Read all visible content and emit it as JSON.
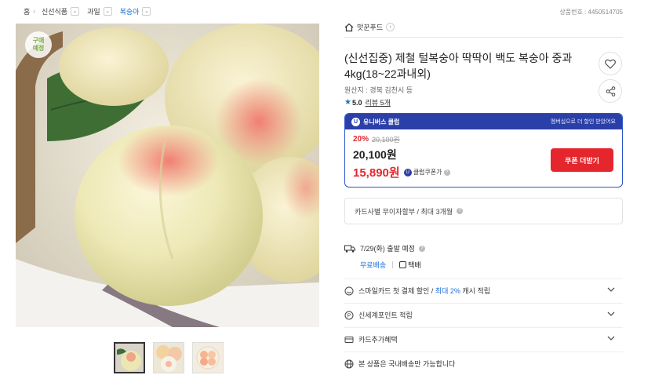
{
  "breadcrumb": [
    {
      "label": "홈"
    },
    {
      "label": "신선식품"
    },
    {
      "label": "과일"
    },
    {
      "label": "복숭아"
    }
  ],
  "product_no": "상품번호 : 4450514705",
  "image": {
    "badge": "구매\n예정"
  },
  "brand": {
    "name": "맛꾼푸드"
  },
  "title": "(신선집중) 제철 털복숭아 딱딱이 백도 복숭아 중과 4kg(18~22과내외)",
  "origin": "원산지 : 경북 김천시 등",
  "rating": {
    "score": "5.0",
    "reviews": "리뷰 5개"
  },
  "club": {
    "name": "유니버스 클럽",
    "promo": "멤버십으로 더 할인 받았어요",
    "discount": "20%",
    "original_price": "20,100원",
    "sale_price": "20,100원",
    "club_price": "15,890원",
    "club_label": "클럽쿠폰가",
    "coupon_button": "쿠폰 더받기"
  },
  "card_installment": "카드사별 무이자할부 / 최대 3개월",
  "shipping": {
    "date": "7/29(화) 출발 예정",
    "free": "무료배송",
    "type": "택배"
  },
  "benefits": {
    "smile_a": "스마일카드 첫 결제 할인 / ",
    "smile_b": "최대 2%",
    "smile_c": " 캐시 적립",
    "shinsegae": "신세계포인트 적립",
    "card_extra": "카드추가혜택",
    "domestic": "본 상품은 국내배송만 가능합니다"
  },
  "colors": {
    "accent_blue": "#1a6fd9",
    "club_navy": "#2b3fa8",
    "sale_red": "#e5262d"
  }
}
